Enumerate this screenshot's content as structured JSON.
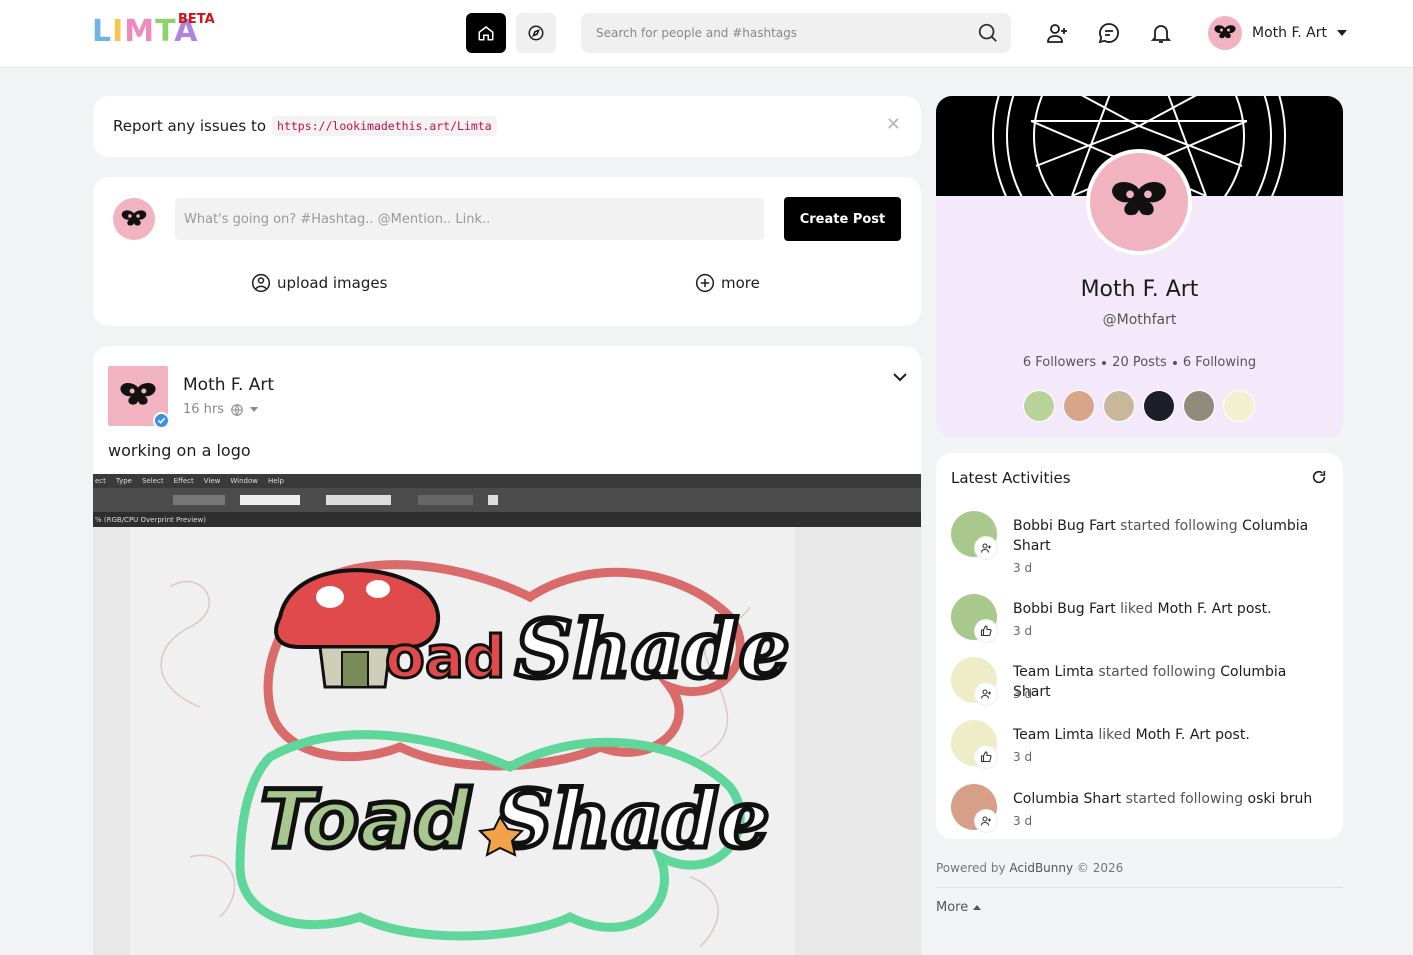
{
  "header": {
    "logo_text": "LIMTA",
    "beta_label": "BETA",
    "search_placeholder": "Search for people and #hashtags",
    "user_name": "Moth F. Art"
  },
  "notice": {
    "text": "Report any issues to",
    "link": "https://lookimadethis.art/Limta"
  },
  "composer": {
    "placeholder": "What's going on? #Hashtag.. @Mention.. Link..",
    "create_label": "Create Post",
    "upload_label": "upload images",
    "more_label": "more"
  },
  "post": {
    "author": "Moth F. Art",
    "time": "16 hrs",
    "body": "working on a logo",
    "image_menu": [
      "ect",
      "Type",
      "Select",
      "Effect",
      "View",
      "Window",
      "Help"
    ],
    "image_tab": "% (RGB/CPU Overprint Preview)"
  },
  "profile": {
    "name": "Moth F. Art",
    "handle": "@Mothfart",
    "followers": "6 Followers",
    "posts": "20 Posts",
    "following": "6 Following",
    "follower_colors": [
      "#b7d39a",
      "#d9a58a",
      "#c9b79a",
      "#1c1f2a",
      "#8f8a7a",
      "#f2f0cf"
    ]
  },
  "activities": {
    "title": "Latest Activities",
    "items": [
      {
        "actor": "Bobbi Bug Fart",
        "action": "started following",
        "target": "Columbia Shart",
        "time": "3 d",
        "type": "follow",
        "color": "#a9c98c"
      },
      {
        "actor": "Bobbi Bug Fart",
        "action": "liked",
        "target": "Moth F. Art post.",
        "time": "3 d",
        "type": "like",
        "color": "#a9c98c"
      },
      {
        "actor": "Team Limta",
        "action": "started following",
        "target": "Columbia Shart",
        "time": "3 d",
        "type": "follow",
        "color": "#efedc8"
      },
      {
        "actor": "Team Limta",
        "action": "liked",
        "target": "Moth F. Art post.",
        "time": "3 d",
        "type": "like",
        "color": "#efedc8"
      },
      {
        "actor": "Columbia Shart",
        "action": "started following",
        "target": "oski bruh",
        "time": "3 d",
        "type": "follow",
        "color": "#d79e88"
      }
    ]
  },
  "footer": {
    "powered_prefix": "Powered by",
    "powered_brand": "AcidBunny",
    "powered_suffix": "© 2026",
    "more_label": "More"
  }
}
